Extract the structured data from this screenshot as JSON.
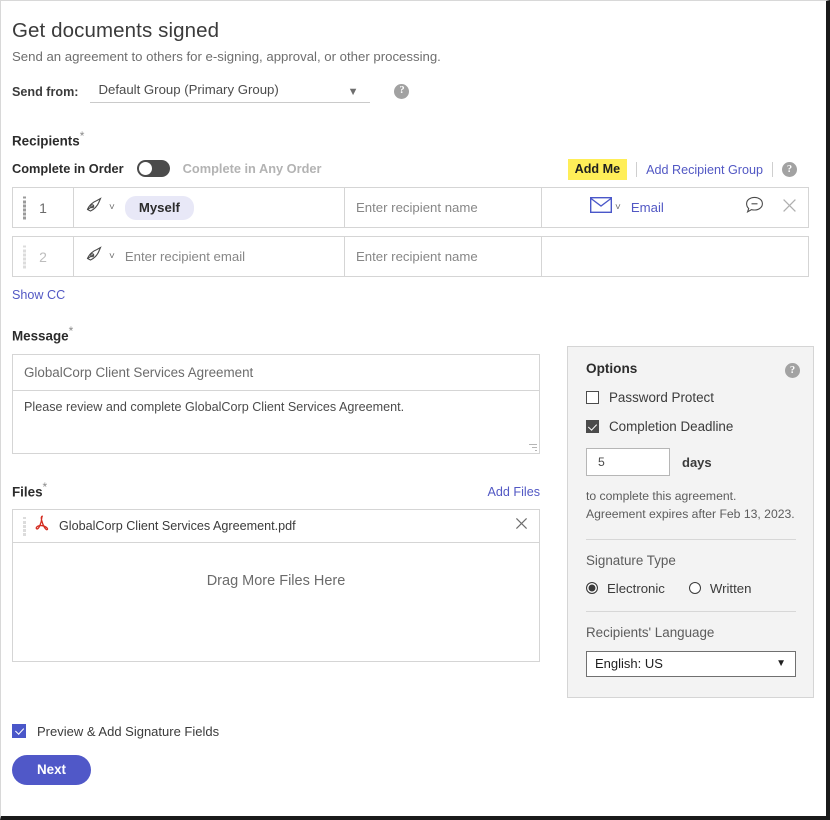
{
  "header": {
    "title": "Get documents signed",
    "subtitle": "Send an agreement to others for e-signing, approval, or other processing.",
    "send_from_label": "Send from:",
    "send_from_value": "Default Group (Primary Group)",
    "help_icon": "help-icon",
    "caret_icon": "chevron-down-icon"
  },
  "recipients": {
    "section_label": "Recipients",
    "required_mark": "*",
    "order_label": "Complete in Order",
    "order_alt_label": "Complete in Any Order",
    "toggle_state": "off",
    "add_me_label": "Add Me",
    "add_me_highlight_color": "#ffee58",
    "add_recipient_group_label": "Add Recipient Group",
    "help_icon": "help-icon",
    "show_cc_label": "Show CC",
    "rows": [
      {
        "number": "1",
        "role_icon": "signature-pen-icon",
        "email_value": "Myself",
        "email_is_pill": true,
        "name_placeholder": "Enter recipient name",
        "delivery_icon": "envelope-icon",
        "delivery_label": "Email",
        "message_icon": "speech-bubble-icon",
        "remove_icon": "close-icon"
      },
      {
        "number": "2",
        "role_icon": "signature-pen-icon",
        "email_placeholder": "Enter recipient email",
        "email_is_pill": false,
        "name_placeholder": "Enter recipient name"
      }
    ]
  },
  "message": {
    "section_label": "Message",
    "required_mark": "*",
    "subject_value": "GlobalCorp Client Services Agreement",
    "body_value": "Please review and complete GlobalCorp Client Services Agreement."
  },
  "files": {
    "section_label": "Files",
    "required_mark": "*",
    "add_files_label": "Add Files",
    "items": [
      {
        "name": "GlobalCorp Client Services Agreement.pdf",
        "icon": "pdf-icon",
        "remove_icon": "close-icon"
      }
    ],
    "drop_zone_label": "Drag More Files Here"
  },
  "options": {
    "title": "Options",
    "help_icon": "help-icon",
    "password_protect_label": "Password Protect",
    "password_protect_checked": false,
    "completion_deadline_label": "Completion Deadline",
    "completion_deadline_checked": true,
    "days_value": "5",
    "days_unit": "days",
    "note_line1": "to complete this agreement.",
    "note_line2": "Agreement expires after Feb 13, 2023.",
    "signature_type_label": "Signature Type",
    "signature_options": [
      {
        "label": "Electronic",
        "selected": true
      },
      {
        "label": "Written",
        "selected": false
      }
    ],
    "language_label": "Recipients' Language",
    "language_value": "English: US",
    "language_caret": "chevron-down-icon"
  },
  "footer": {
    "preview_label": "Preview & Add Signature Fields",
    "preview_checked": true,
    "next_label": "Next",
    "next_color": "#5058c8"
  }
}
